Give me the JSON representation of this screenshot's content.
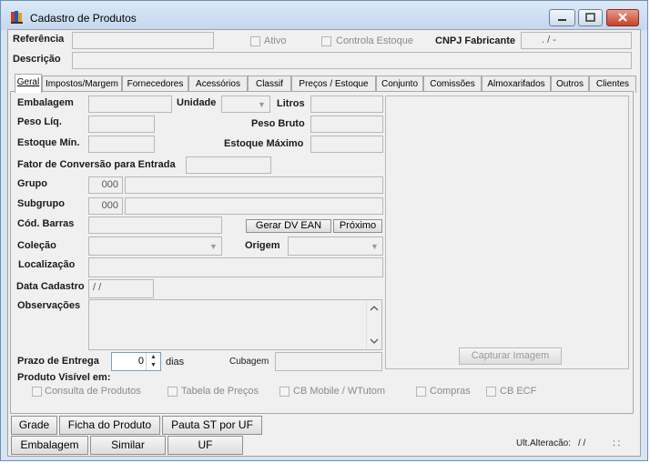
{
  "window": {
    "title": "Cadastro de Produtos",
    "close_glyph": "✕",
    "min_glyph": "▬",
    "max_glyph": "◻"
  },
  "header": {
    "referencia_label": "Referência",
    "ativo_label": "Ativo",
    "controla_estoque_label": "Controla Estoque",
    "cnpj_label": "CNPJ Fabricante",
    "cnpj_value": "  .   /   -",
    "descricao_label": "Descrição"
  },
  "tabs": [
    "Geral",
    "Impostos/Margem",
    "Fornecedores",
    "Acessórios",
    "Classif",
    "Preços / Estoque",
    "Conjunto",
    "Comissões",
    "Almoxarifados",
    "Outros",
    "Clientes"
  ],
  "geral": {
    "embalagem_label": "Embalagem",
    "unidade_label": "Unidade",
    "litros_label": "Litros",
    "peso_liq_label": "Peso Líq.",
    "peso_bruto_label": "Peso Bruto",
    "estoque_min_label": "Estoque Mín.",
    "estoque_max_label": "Estoque Máximo",
    "fator_label": "Fator de Conversão para Entrada",
    "grupo_label": "Grupo",
    "grupo_code": "000",
    "subgrupo_label": "Subgrupo",
    "subgrupo_code": "000",
    "cod_barras_label": "Cód. Barras",
    "gerar_dv_label": "Gerar DV EAN",
    "proximo_label": "Próximo",
    "colecao_label": "Coleção",
    "origem_label": "Origem",
    "localizacao_label": "Localização",
    "data_cadastro_label": "Data Cadastro",
    "data_cadastro_value": "  / /",
    "observacoes_label": "Observações",
    "prazo_label": "Prazo de Entrega",
    "prazo_value": "0",
    "dias_label": "dias",
    "cubagem_label": "Cubagem",
    "capturar_label": "Capturar Imagem",
    "visivel_label": "Produto Visível em:",
    "visivel_options": [
      "Consulta de Produtos",
      "Tabela de Preços",
      "CB Mobile / WTutom",
      "Compras",
      "CB ECF"
    ]
  },
  "footer": {
    "buttons_row1": [
      "Grade",
      "Ficha do Produto",
      "Pauta ST por UF"
    ],
    "buttons_row2": [
      "Embalagem",
      "Similar",
      "UF"
    ],
    "ult_alteracao_label": "Ult.Alteracão:",
    "ult_alteracao_date": "/ /",
    "ult_alteracao_time": ":  :"
  }
}
